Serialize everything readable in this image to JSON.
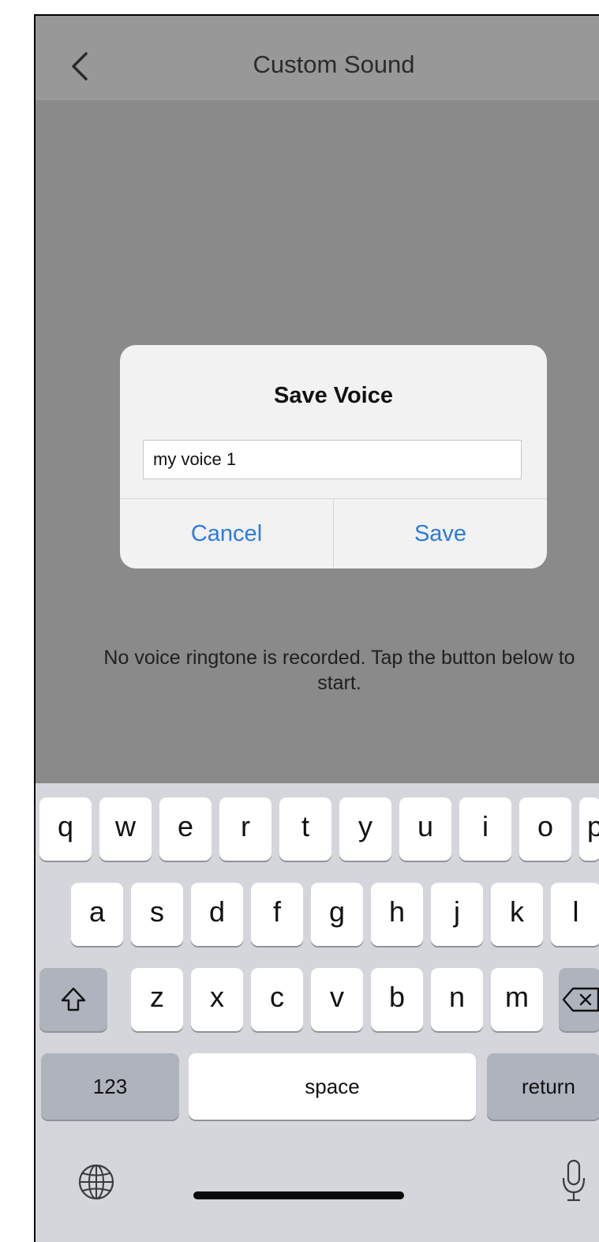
{
  "nav": {
    "title": "Custom Sound"
  },
  "content": {
    "empty_message": "No voice ringtone is recorded. Tap the button below to start."
  },
  "dialog": {
    "title": "Save Voice",
    "input_value": "my voice 1",
    "cancel_label": "Cancel",
    "save_label": "Save"
  },
  "keyboard": {
    "row1": [
      "q",
      "w",
      "e",
      "r",
      "t",
      "y",
      "u",
      "i",
      "o",
      "p"
    ],
    "row2": [
      "a",
      "s",
      "d",
      "f",
      "g",
      "h",
      "j",
      "k",
      "l"
    ],
    "row3": [
      "z",
      "x",
      "c",
      "v",
      "b",
      "n",
      "m"
    ],
    "numbers_label": "123",
    "space_label": "space",
    "return_label": "return"
  },
  "colors": {
    "accent": "#2d7be0",
    "dim_overlay": "#8a8a8a",
    "keyboard_bg": "#d4d6db"
  }
}
